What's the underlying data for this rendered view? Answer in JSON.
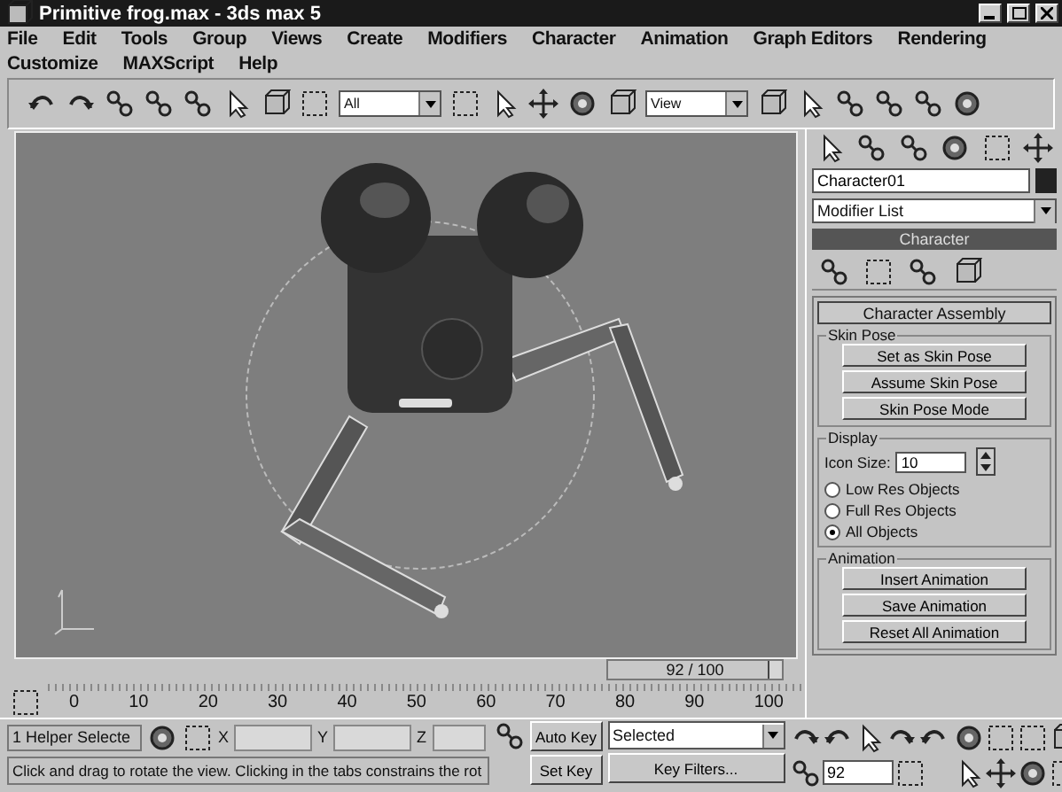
{
  "window": {
    "title": "Primitive frog.max - 3ds max 5"
  },
  "menu": [
    [
      "File",
      "Edit",
      "Tools",
      "Group",
      "Views",
      "Create",
      "Modifiers",
      "Character",
      "Animation",
      "Graph Editors",
      "Rendering"
    ],
    [
      "Customize",
      "MAXScript",
      "Help"
    ]
  ],
  "toolbar": {
    "selection_filter": "All",
    "reference_coord": "View"
  },
  "viewport": {
    "time_slider": {
      "label": "92 / 100",
      "level": 0.92
    }
  },
  "track_bar": {
    "ticks": [
      "0",
      "10",
      "20",
      "30",
      "40",
      "50",
      "60",
      "70",
      "80",
      "90",
      "100"
    ]
  },
  "command_panel": {
    "object_name": "Character01",
    "modifier_list": "Modifier List",
    "stack_item": "Character",
    "rollout": {
      "title": "Character Assembly",
      "groups": [
        {
          "title": "Skin Pose",
          "items": [
            {
              "kind": "button",
              "label": "Set as Skin Pose"
            },
            {
              "kind": "button",
              "label": "Assume Skin Pose"
            },
            {
              "kind": "button",
              "label": "Skin Pose Mode"
            }
          ]
        },
        {
          "title": "Display",
          "items": [
            {
              "kind": "spinner",
              "label": "Icon Size:",
              "value": "10"
            },
            {
              "kind": "radio",
              "label": "Low Res Objects",
              "selected": false
            },
            {
              "kind": "radio",
              "label": "Full Res Objects",
              "selected": false
            },
            {
              "kind": "radio",
              "label": "All Objects",
              "selected": true
            }
          ]
        },
        {
          "title": "Animation",
          "items": [
            {
              "kind": "button",
              "label": "Insert Animation"
            },
            {
              "kind": "button",
              "label": "Save Animation"
            },
            {
              "kind": "button",
              "label": "Reset All Animation"
            }
          ]
        }
      ]
    }
  },
  "status_bar": {
    "selection": "1 Helper Selecte",
    "x_label": "X",
    "y_label": "Y",
    "z_label": "Z",
    "prompt": "Click and drag to rotate the view.  Clicking in the tabs constrains the rot",
    "auto_key": "Auto Key",
    "key_mode": "Selected",
    "set_key": "Set Key",
    "key_filters": "Key Filters...",
    "frame": "92"
  }
}
